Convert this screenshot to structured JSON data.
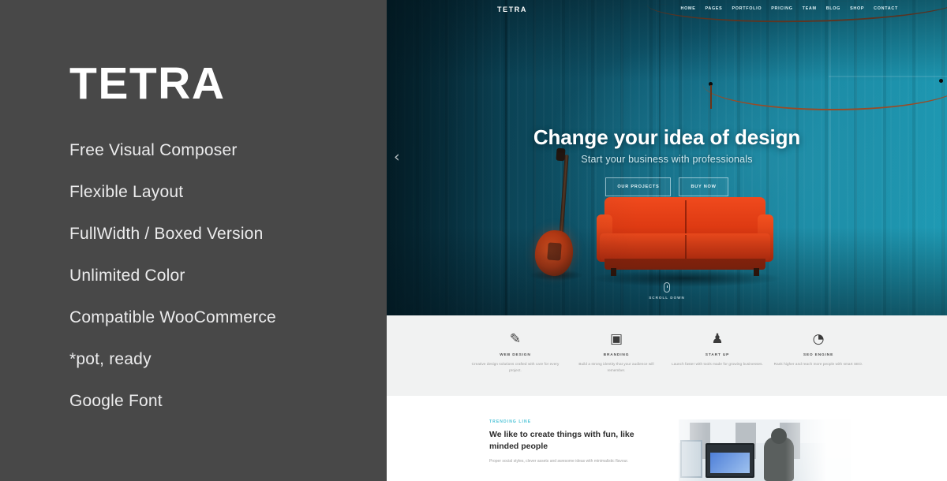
{
  "promo": {
    "title": "TETRA",
    "features": [
      "Free Visual Composer",
      "Flexible Layout",
      "FullWidth / Boxed Version",
      "Unlimited Color",
      "Compatible WooCommerce",
      "*pot, ready",
      "Google Font"
    ],
    "background_color": "#484848",
    "text_color": "#ececed"
  },
  "preview": {
    "nav": {
      "logo": "TETRA",
      "items": [
        {
          "label": "Home"
        },
        {
          "label": "Pages"
        },
        {
          "label": "Portfolio"
        },
        {
          "label": "Pricing"
        },
        {
          "label": "Team"
        },
        {
          "label": "Blog"
        },
        {
          "label": "Shop"
        },
        {
          "label": "Contact"
        }
      ]
    },
    "hero": {
      "heading": "Change your idea of design",
      "subheading": "Start your business with professionals",
      "buttons": [
        {
          "label": "Our Projects"
        },
        {
          "label": "Buy Now"
        }
      ],
      "prev_arrow": "‹",
      "scroll_label": "Scroll Down",
      "colors": {
        "wall_dark": "#0b4356",
        "wall_light": "#1f9cb6",
        "sofa": "#e8391a",
        "cable": "#8d4524"
      }
    },
    "features": [
      {
        "icon": "brush-icon",
        "glyph": "✎",
        "title": "Web Design",
        "desc": "Creative design solutions crafted with care for every project."
      },
      {
        "icon": "camera-icon",
        "glyph": "▣",
        "title": "Branding",
        "desc": "Build a strong identity that your audience will remember."
      },
      {
        "icon": "rocket-icon",
        "glyph": "♟",
        "title": "Start Up",
        "desc": "Launch faster with tools made for growing businesses."
      },
      {
        "icon": "pie-chart-icon",
        "glyph": "◔",
        "title": "Seo Engine",
        "desc": "Rank higher and reach more people with smart SEO."
      }
    ],
    "content": {
      "eyebrow": "Trending Line",
      "heading": "We like to create things with fun, like minded people",
      "paragraph": "Proper social styles, clever assets and awesome ideas with minimalistic flavour."
    }
  }
}
